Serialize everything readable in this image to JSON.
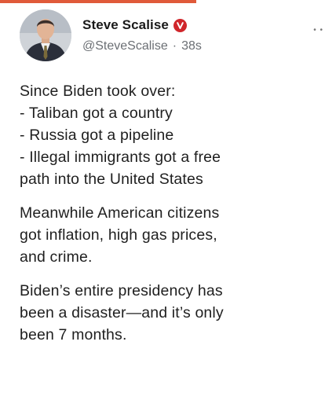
{
  "tweet": {
    "author": {
      "display_name": "Steve Scalise",
      "handle": "@SteveScalise",
      "verified_icon": "verified-badge-icon",
      "avatar_icon": "avatar"
    },
    "separator": "·",
    "timestamp": "38s",
    "more_icon": "more-options-icon",
    "paragraphs": [
      {
        "lines": [
          "Since Biden took over:",
          "- Taliban got a country",
          "- Russia got a pipeline",
          "- Illegal immigrants got a free",
          "path into the United States"
        ]
      },
      {
        "lines": [
          "Meanwhile American citizens",
          "got inflation, high gas prices,",
          "and crime."
        ]
      },
      {
        "lines": [
          "Biden’s entire presidency has",
          "been a disaster—and it’s only",
          "been 7 months."
        ]
      }
    ]
  },
  "colors": {
    "accent_bar": "#e05a3a",
    "verified_badge": "#d0262b",
    "secondary_text": "#6b6f74",
    "body_text": "#1f1f1f"
  }
}
